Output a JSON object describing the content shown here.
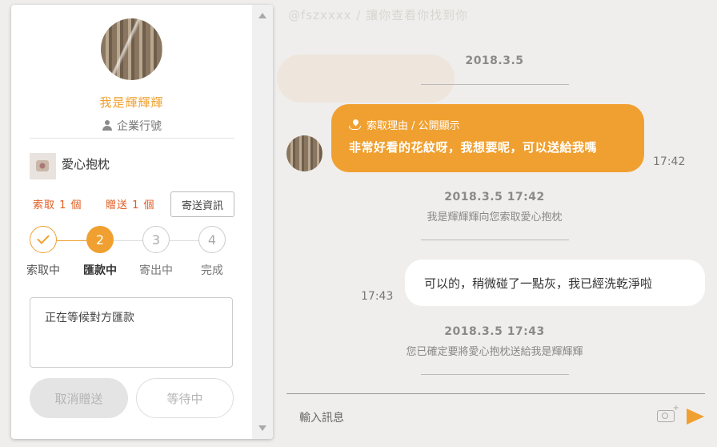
{
  "background": {
    "header": "@fszxxxx / 讓你查看你找到你"
  },
  "profile": {
    "username": "我是輝輝輝",
    "account_type": "企業行號"
  },
  "item": {
    "name": "愛心抱枕"
  },
  "counts": {
    "request": "索取 1 個",
    "give": "贈送 1 個"
  },
  "shipping_button": "寄送資訊",
  "steps": [
    {
      "number": "",
      "label": "索取中",
      "state": "done"
    },
    {
      "number": "2",
      "label": "匯款中",
      "state": "active"
    },
    {
      "number": "3",
      "label": "寄出中",
      "state": "todo"
    },
    {
      "number": "4",
      "label": "完成",
      "state": "todo"
    }
  ],
  "status_message": "正在等候對方匯款",
  "buttons": {
    "cancel": "取消贈送",
    "waiting": "等待中"
  },
  "chat": {
    "system_1": {
      "date": "2018.3.5"
    },
    "message_1": {
      "tag": "索取理由 / 公開顯示",
      "text": "非常好看的花紋呀，我想要呢，可以送給我嗎",
      "time": "17:42"
    },
    "system_2": {
      "date": "2018.3.5 17:42",
      "text": "我是輝輝輝向您索取愛心抱枕"
    },
    "message_2": {
      "text": "可以的，稍微碰了一點灰，我已經洗乾淨啦",
      "time": "17:43"
    },
    "system_3": {
      "date": "2018.3.5 17:43",
      "text": "您已確定要將愛心抱枕送給我是輝輝輝"
    }
  },
  "input": {
    "placeholder": "輸入訊息"
  },
  "colors": {
    "accent": "#f0a030",
    "count_red": "#e05a20"
  },
  "icons": [
    "person-icon",
    "hand-heart-icon",
    "camera-icon",
    "send-icon",
    "check-icon"
  ]
}
